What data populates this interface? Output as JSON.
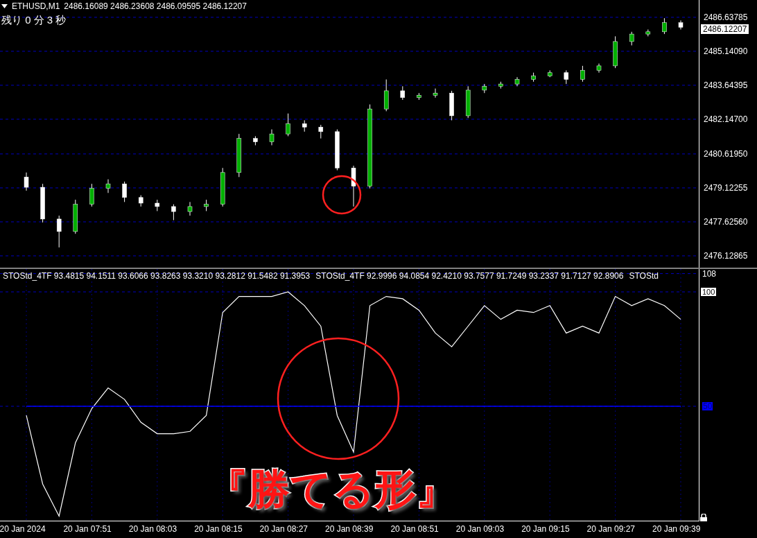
{
  "header": {
    "symbol": "ETHUSD,M1",
    "quote": "2486.16089 2486.23608 2486.09595 2486.12207",
    "countdown": "残り 0 分 3 秒"
  },
  "price_chart": {
    "current_price": "2486.12207",
    "chart_data": {
      "type": "candlestick",
      "grid": true,
      "categories": [
        null,
        null,
        null,
        null,
        null,
        null,
        null,
        null,
        null,
        null,
        null,
        null,
        null,
        null,
        null,
        null,
        null,
        null,
        null,
        null,
        null,
        null,
        null,
        null,
        null,
        null,
        null,
        null,
        null,
        null,
        null,
        null,
        null,
        null,
        null,
        null,
        null,
        null,
        null,
        null,
        null
      ],
      "ohlc": [
        [
          2479.6,
          2479.8,
          2479.0,
          2479.15
        ],
        [
          2479.15,
          2479.3,
          2477.6,
          2477.75
        ],
        [
          2477.75,
          2477.9,
          2476.5,
          2477.2
        ],
        [
          2477.2,
          2478.6,
          2477.1,
          2478.4
        ],
        [
          2478.4,
          2479.3,
          2478.3,
          2479.1
        ],
        [
          2479.1,
          2479.5,
          2478.9,
          2479.3
        ],
        [
          2479.3,
          2479.4,
          2478.5,
          2478.7
        ],
        [
          2478.7,
          2478.8,
          2478.3,
          2478.45
        ],
        [
          2478.45,
          2478.6,
          2478.1,
          2478.3
        ],
        [
          2478.3,
          2478.4,
          2477.7,
          2478.08
        ],
        [
          2478.08,
          2478.5,
          2477.9,
          2478.3
        ],
        [
          2478.3,
          2478.6,
          2478.1,
          2478.4
        ],
        [
          2478.4,
          2480.0,
          2478.3,
          2479.8
        ],
        [
          2479.8,
          2481.5,
          2479.6,
          2481.3
        ],
        [
          2481.3,
          2481.4,
          2481.0,
          2481.15
        ],
        [
          2481.15,
          2481.7,
          2481.0,
          2481.5
        ],
        [
          2481.5,
          2482.4,
          2481.4,
          2481.95
        ],
        [
          2481.95,
          2482.1,
          2481.6,
          2481.8
        ],
        [
          2481.8,
          2481.9,
          2481.3,
          2481.6
        ],
        [
          2481.6,
          2481.7,
          2479.9,
          2480.0
        ],
        [
          2480.0,
          2480.1,
          2478.3,
          2479.2
        ],
        [
          2479.2,
          2482.8,
          2479.1,
          2482.6
        ],
        [
          2482.6,
          2483.9,
          2482.5,
          2483.4
        ],
        [
          2483.4,
          2483.6,
          2483.0,
          2483.1
        ],
        [
          2483.1,
          2483.3,
          2483.0,
          2483.2
        ],
        [
          2483.2,
          2483.5,
          2483.1,
          2483.3
        ],
        [
          2483.3,
          2483.4,
          2482.1,
          2482.3
        ],
        [
          2482.3,
          2483.6,
          2482.2,
          2483.43
        ],
        [
          2483.43,
          2483.7,
          2483.3,
          2483.6
        ],
        [
          2483.6,
          2483.8,
          2483.5,
          2483.7
        ],
        [
          2483.7,
          2484.0,
          2483.6,
          2483.9
        ],
        [
          2483.9,
          2484.2,
          2483.8,
          2484.05
        ],
        [
          2484.05,
          2484.3,
          2484.0,
          2484.2
        ],
        [
          2484.2,
          2484.3,
          2483.7,
          2483.9
        ],
        [
          2483.9,
          2484.5,
          2483.8,
          2484.3
        ],
        [
          2484.3,
          2484.6,
          2484.2,
          2484.5
        ],
        [
          2484.5,
          2485.8,
          2484.4,
          2485.57
        ],
        [
          2485.57,
          2486.0,
          2485.4,
          2485.9
        ],
        [
          2485.9,
          2486.1,
          2485.8,
          2486.0
        ],
        [
          2486.0,
          2486.6,
          2485.9,
          2486.4
        ],
        [
          2486.4,
          2486.5,
          2486.1,
          2486.2
        ]
      ],
      "ylim": [
        2475.64,
        2487.4
      ],
      "yticks": [
        {
          "value": 2486.63785,
          "label": "2486.63785"
        },
        {
          "value": 2485.1409,
          "label": "2485.14090"
        },
        {
          "value": 2483.64395,
          "label": "2483.64395"
        },
        {
          "value": 2482.147,
          "label": "2482.14700"
        },
        {
          "value": 2480.6195,
          "label": "2480.61950"
        },
        {
          "value": 2479.12255,
          "label": "2479.12255"
        },
        {
          "value": 2477.6256,
          "label": "2477.62560"
        },
        {
          "value": 2476.12865,
          "label": "2476.12865"
        }
      ]
    }
  },
  "indicator": {
    "legends": [
      "STOStd_4TF 93.4815 94.1511 93.6066 93.8263 93.3210 93.2812 91.5482 91.3953",
      "STOStd_4TF 92.9996 94.0854 92.4210 93.7577 91.7249 93.2337 91.7127 92.8906",
      "STOStd"
    ],
    "chart_data": {
      "type": "line",
      "grid": true,
      "categories": [
        "20 Jan 2024",
        null,
        null,
        null,
        "20 Jan 07:51",
        null,
        null,
        null,
        "20 Jan 08:03",
        null,
        null,
        null,
        "20 Jan 08:15",
        null,
        null,
        null,
        "20 Jan 08:27",
        null,
        null,
        null,
        "20 Jan 08:39",
        null,
        null,
        null,
        "20 Jan 08:51",
        null,
        null,
        null,
        "20 Jan 09:03",
        null,
        null,
        null,
        "20 Jan 09:15",
        null,
        null,
        null,
        "20 Jan 09:27",
        null,
        null,
        null,
        "20 Jan 09:39"
      ],
      "series": [
        {
          "color": "#ffffff",
          "values": [
            46,
            16,
            2,
            34,
            49,
            58,
            53,
            43,
            38,
            38,
            39,
            46,
            91,
            98,
            98,
            98,
            100,
            94,
            85,
            46,
            30,
            94,
            98,
            97,
            92,
            82,
            76,
            85,
            94,
            88,
            92,
            91,
            94,
            82,
            85,
            82,
            98,
            94,
            97,
            94,
            88
          ]
        },
        {
          "color": "#0000ff",
          "values": [
            50,
            50,
            50,
            50,
            50,
            50,
            50,
            50,
            50,
            50,
            50,
            50,
            50,
            50,
            50,
            50,
            50,
            50,
            50,
            50,
            50,
            50,
            50,
            50,
            50,
            50,
            50,
            50,
            50,
            50,
            50,
            50,
            50,
            50,
            50,
            50,
            50,
            50,
            50,
            50,
            50
          ]
        }
      ],
      "ylim": [
        0,
        110
      ],
      "yticks": [
        {
          "value": 50,
          "label": "50"
        },
        {
          "value": 100,
          "label": "100"
        },
        {
          "value": 108,
          "label": "108"
        }
      ]
    }
  },
  "caption": "『勝てる形』"
}
